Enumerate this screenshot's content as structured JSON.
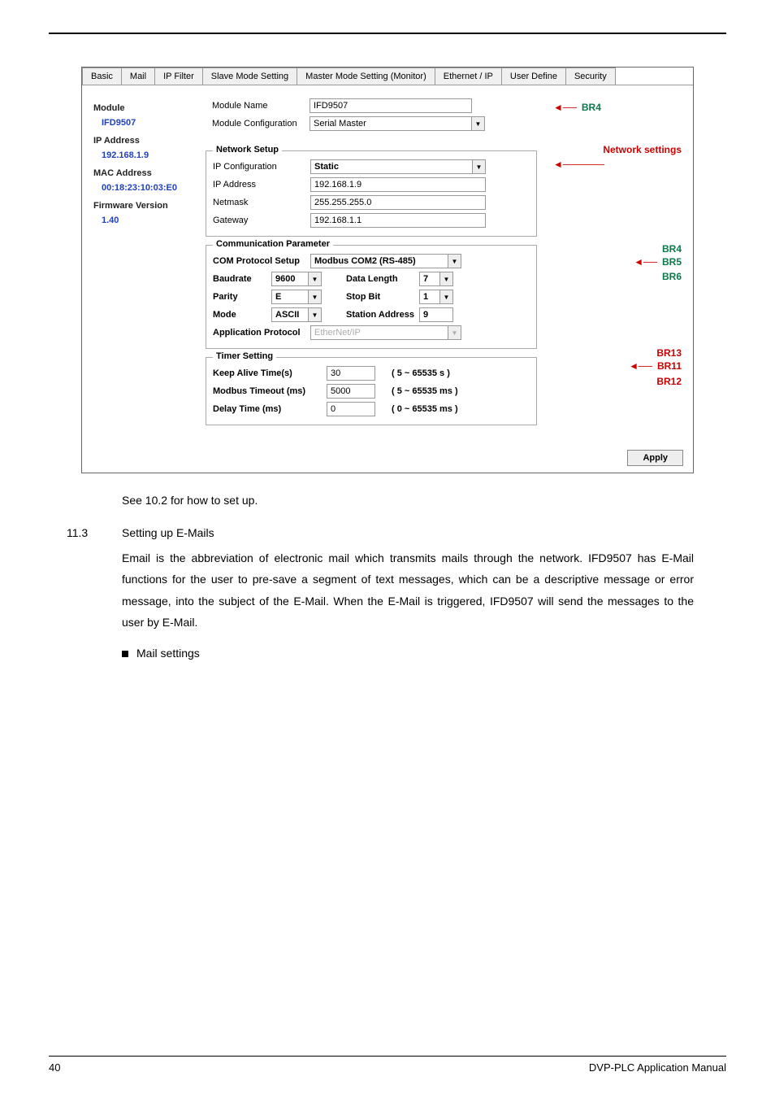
{
  "tabs": [
    "Basic",
    "Mail",
    "IP Filter",
    "Slave Mode Setting",
    "Master Mode Setting (Monitor)",
    "Ethernet / IP",
    "User Define",
    "Security"
  ],
  "side": {
    "module_label": "Module",
    "module": "IFD9507",
    "ip_label": "IP Address",
    "ip": "192.168.1.9",
    "mac_label": "MAC Address",
    "mac": "00:18:23:10:03:E0",
    "fw_label": "Firmware Version",
    "fw": "1.40"
  },
  "top": {
    "mn_label": "Module Name",
    "mn": "IFD9507",
    "mc_label": "Module Configuration",
    "mc": "Serial Master"
  },
  "net": {
    "legend": "Network Setup",
    "ipc_label": "IP Configuration",
    "ipc": "Static",
    "ip_label": "IP Address",
    "ip": "192.168.1.9",
    "nm_label": "Netmask",
    "nm": "255.255.255.0",
    "gw_label": "Gateway",
    "gw": "192.168.1.1"
  },
  "comm": {
    "legend": "Communication Parameter",
    "cps_label": "COM Protocol Setup",
    "cps": "Modbus COM2 (RS-485)",
    "br_label": "Baudrate",
    "br": "9600",
    "dl_label": "Data Length",
    "dl": "7",
    "pa_label": "Parity",
    "pa": "E",
    "sb_label": "Stop Bit",
    "sb": "1",
    "md_label": "Mode",
    "md": "ASCII",
    "sa_label": "Station Address",
    "sa": "9",
    "ap_label": "Application Protocol",
    "ap": "EtherNet/IP"
  },
  "timer": {
    "legend": "Timer Setting",
    "ka_label": "Keep Alive Time(s)",
    "ka": "30",
    "ka_range": "( 5 ~ 65535 s )",
    "mt_label": "Modbus Timeout (ms)",
    "mt": "5000",
    "mt_range": "( 5 ~ 65535 ms )",
    "dt_label": "Delay Time (ms)",
    "dt": "0",
    "dt_range": "( 0 ~ 65535 ms )"
  },
  "apply": "Apply",
  "ann": {
    "br4": "BR4",
    "netset": "Network settings",
    "g1": "BR4",
    "g2": "BR5",
    "g3": "BR6",
    "br13": "BR13",
    "br11": "BR11",
    "br12": "BR12"
  },
  "caption": "See 10.2 for how to set up.",
  "sec": {
    "num": "11.3",
    "title": "Setting up E-Mails"
  },
  "para": "Email is the abbreviation of electronic mail which transmits mails through the network. IFD9507 has E-Mail functions for the user to pre-save a segment of text messages, which can be a descriptive message or error message, into the subject of the E-Mail. When the E-Mail is triggered, IFD9507 will send the messages to the user by E-Mail.",
  "bullet": "Mail settings",
  "footer": {
    "page": "40",
    "doc": "DVP-PLC  Application  Manual"
  }
}
